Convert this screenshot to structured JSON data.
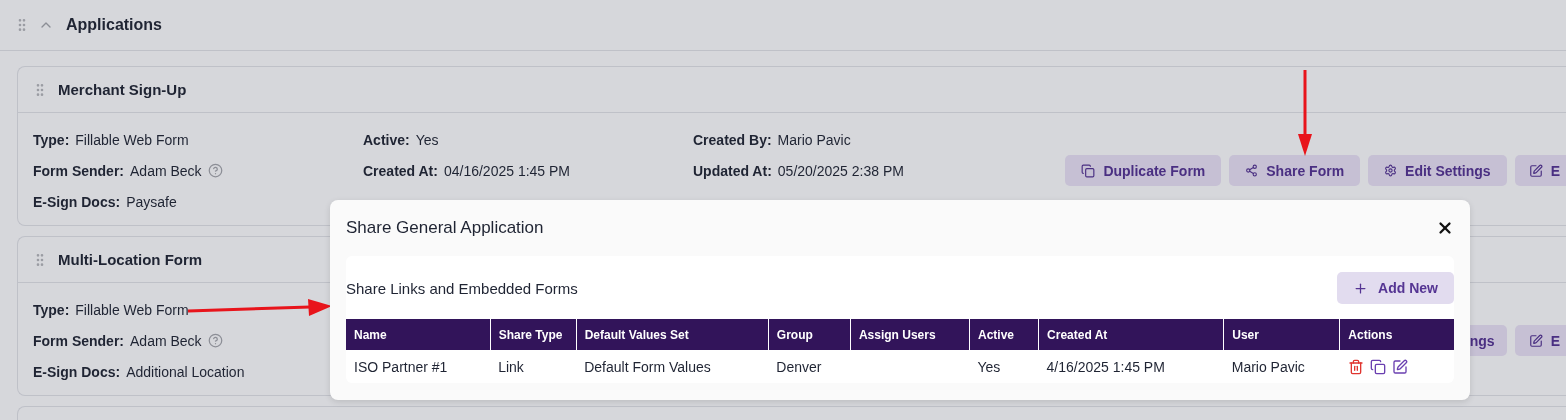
{
  "section": {
    "title": "Applications",
    "expanded": true
  },
  "forms": [
    {
      "title": "Merchant Sign-Up",
      "columns": [
        [
          {
            "label": "Type:",
            "value": "Fillable Web Form"
          },
          {
            "label": "Form Sender:",
            "value": "Adam Beck",
            "help": true
          },
          {
            "label": "E-Sign Docs:",
            "value": "Paysafe"
          }
        ],
        [
          {
            "label": "Active:",
            "value": "Yes"
          },
          {
            "label": "Created At:",
            "value": "04/16/2025 1:45 PM"
          }
        ],
        [
          {
            "label": "Created By:",
            "value": "Mario Pavic"
          },
          {
            "label": "Updated At:",
            "value": "05/20/2025 2:38 PM"
          }
        ]
      ],
      "buttons": [
        {
          "kind": "copy",
          "label": "Duplicate Form"
        },
        {
          "kind": "share",
          "label": "Share Form"
        },
        {
          "kind": "settings",
          "label": "Edit Settings"
        },
        {
          "kind": "edit",
          "label": "E"
        }
      ]
    },
    {
      "title": "Multi-Location Form",
      "columns": [
        [
          {
            "label": "Type:",
            "value": "Fillable Web Form"
          },
          {
            "label": "Form Sender:",
            "value": "Adam Beck",
            "help": true
          },
          {
            "label": "E-Sign Docs:",
            "value": "Additional Location"
          }
        ]
      ],
      "buttons": [
        {
          "kind": "text",
          "label": "ngs"
        },
        {
          "kind": "edit",
          "label": "E"
        }
      ]
    },
    {
      "kind": "empty"
    }
  ],
  "modal": {
    "title": "Share General Application",
    "panel_title": "Share Links and Embedded Forms",
    "add_button": "Add New",
    "table": {
      "columns": [
        "Name",
        "Share Type",
        "Default Values Set",
        "Group",
        "Assign Users",
        "Active",
        "Created At",
        "User",
        "Actions"
      ],
      "rows": [
        {
          "cells": [
            "ISO Partner #1",
            "Link",
            "Default Form Values",
            "Denver",
            "",
            "Yes",
            "4/16/2025 1:45 PM",
            "Mario Pavic"
          ],
          "actions": [
            {
              "kind": "delete"
            },
            {
              "kind": "copy"
            },
            {
              "kind": "edit"
            }
          ]
        }
      ]
    }
  },
  "annotations": [
    {
      "kind": "down"
    },
    {
      "kind": "right"
    }
  ]
}
